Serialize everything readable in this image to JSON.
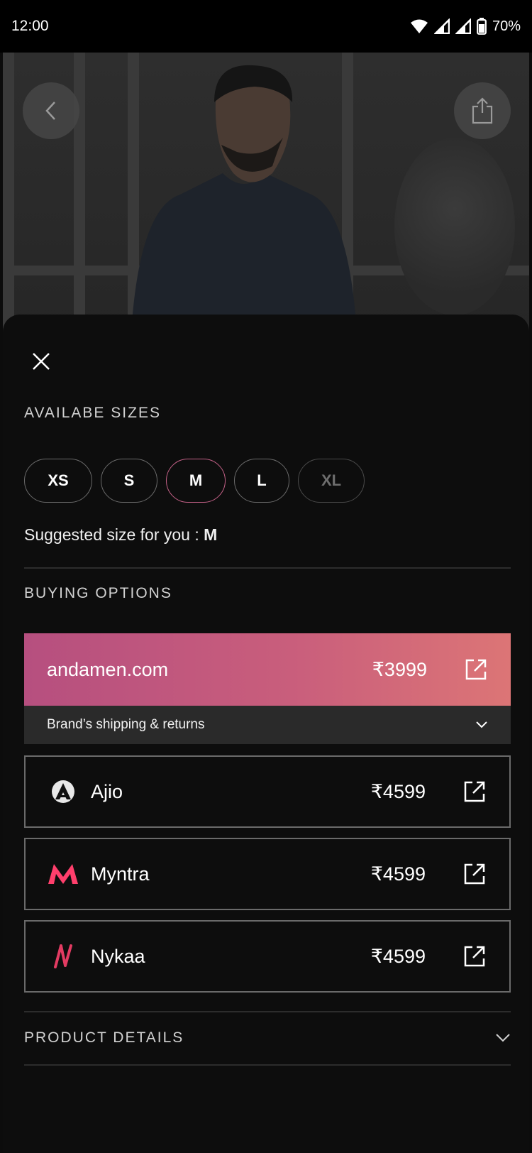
{
  "status_bar": {
    "time": "12:00",
    "battery": "70%"
  },
  "hero": {
    "back_icon": "chevron-left-icon",
    "share_icon": "share-icon"
  },
  "sheet": {
    "close_icon": "close-icon",
    "sizes": {
      "title": "AVAILABE SIZES",
      "options": [
        {
          "label": "XS",
          "state": "available"
        },
        {
          "label": "S",
          "state": "available"
        },
        {
          "label": "M",
          "state": "selected"
        },
        {
          "label": "L",
          "state": "available"
        },
        {
          "label": "XL",
          "state": "unavailable"
        }
      ],
      "suggested_prefix": "Suggested size for you : ",
      "suggested_size": "M"
    },
    "buying": {
      "title": "BUYING OPTIONS",
      "primary": {
        "name": "andamen.com",
        "price": "₹3999"
      },
      "shipping_label": "Brand’s shipping & returns",
      "others": [
        {
          "name": "Ajio",
          "price": "₹4599",
          "logo": "ajio-logo-icon"
        },
        {
          "name": "Myntra",
          "price": "₹4599",
          "logo": "myntra-logo-icon"
        },
        {
          "name": "Nykaa",
          "price": "₹4599",
          "logo": "nykaa-logo-icon"
        }
      ]
    },
    "product_details": {
      "title": "PRODUCT DETAILS"
    }
  },
  "colors": {
    "accent": "#c46187",
    "gradient_start": "#b64f7f",
    "gradient_end": "#dc7576",
    "myntra": "#ff3f6c",
    "nykaa": "#e23b62"
  }
}
